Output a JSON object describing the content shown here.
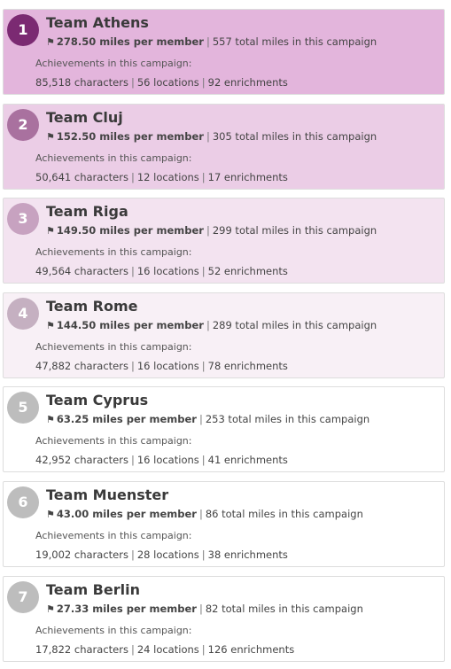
{
  "achievements_label": "Achievements in this campaign:",
  "flag_icon": "checkered-flag-icon",
  "teams": [
    {
      "rank": "1",
      "name": "Team Athens",
      "miles_per_member": "278.50 miles per member",
      "total_miles": "557 total miles in this campaign",
      "characters": "85,518 characters",
      "locations": "56 locations",
      "enrichments": "92 enrichments",
      "card_color": "#e3b5dc",
      "badge_color": "#7b2a72"
    },
    {
      "rank": "2",
      "name": "Team Cluj",
      "miles_per_member": "152.50 miles per member",
      "total_miles": "305 total miles in this campaign",
      "characters": "50,641 characters",
      "locations": "12 locations",
      "enrichments": "17 enrichments",
      "card_color": "#ebcde6",
      "badge_color": "#a9719f"
    },
    {
      "rank": "3",
      "name": "Team Riga",
      "miles_per_member": "149.50 miles per member",
      "total_miles": "299 total miles in this campaign",
      "characters": "49,564 characters",
      "locations": "16 locations",
      "enrichments": "52 enrichments",
      "card_color": "#f3e3f0",
      "badge_color": "#c7a2c0"
    },
    {
      "rank": "4",
      "name": "Team Rome",
      "miles_per_member": "144.50 miles per member",
      "total_miles": "289 total miles in this campaign",
      "characters": "47,882 characters",
      "locations": "16 locations",
      "enrichments": "78 enrichments",
      "card_color": "#f8f0f6",
      "badge_color": "#c5b0c1"
    },
    {
      "rank": "5",
      "name": "Team Cyprus",
      "miles_per_member": "63.25 miles per member",
      "total_miles": "253 total miles in this campaign",
      "characters": "42,952 characters",
      "locations": "16 locations",
      "enrichments": "41 enrichments",
      "card_color": "#ffffff",
      "badge_color": "#bdbdbd"
    },
    {
      "rank": "6",
      "name": "Team Muenster",
      "miles_per_member": "43.00 miles per member",
      "total_miles": "86 total miles in this campaign",
      "characters": "19,002 characters",
      "locations": "28 locations",
      "enrichments": "38 enrichments",
      "card_color": "#ffffff",
      "badge_color": "#bdbdbd"
    },
    {
      "rank": "7",
      "name": "Team Berlin",
      "miles_per_member": "27.33 miles per member",
      "total_miles": "82 total miles in this campaign",
      "characters": "17,822 characters",
      "locations": "24 locations",
      "enrichments": "126 enrichments",
      "card_color": "#ffffff",
      "badge_color": "#bdbdbd"
    }
  ]
}
